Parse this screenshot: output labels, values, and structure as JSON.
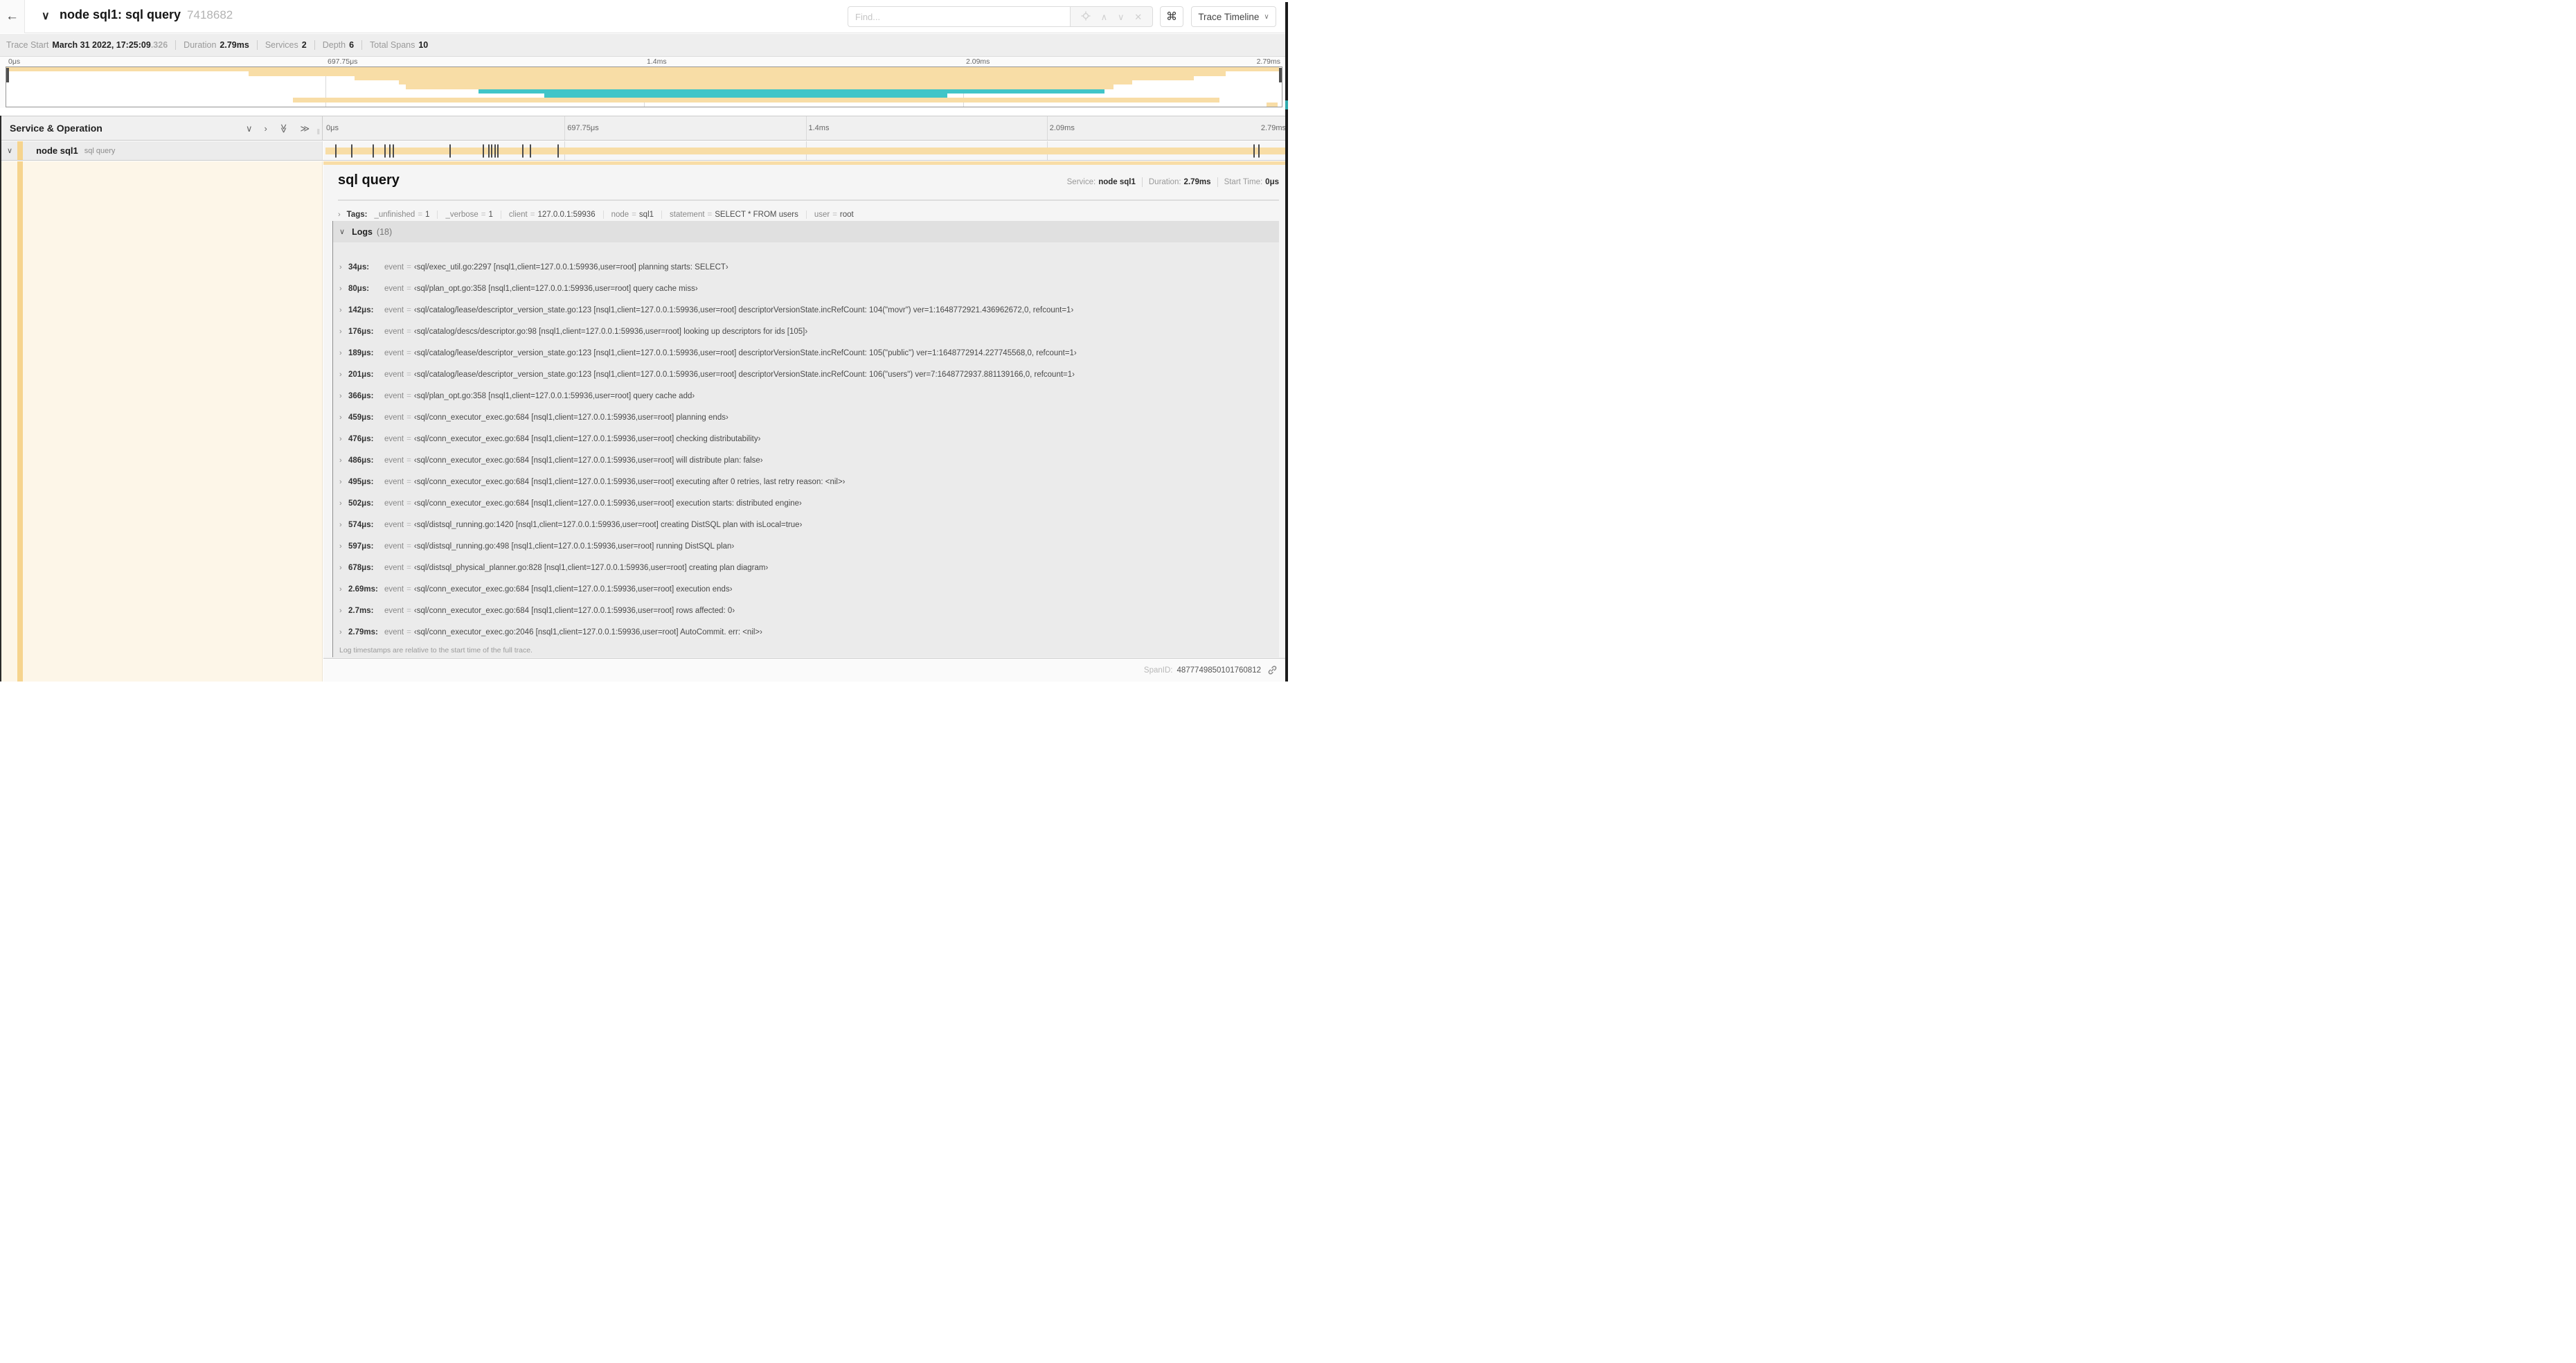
{
  "colors": {
    "tan": "#f8dda6",
    "teal": "#41c5c8",
    "accent": "#f6d48e",
    "cream": "#fdf6e8"
  },
  "icons": {
    "back": "←",
    "title_chevron": "∨",
    "command": "⌘",
    "view_chevron": "∨",
    "collapse_one": "∨",
    "expand_one": "›",
    "collapse_all": "≫",
    "expand_all": "≫",
    "grip": "‖",
    "nav_up": "∧",
    "nav_down": "∨",
    "close": "✕",
    "row_chevron": "∨",
    "tags_chevron": "›",
    "logs_chevron": "∨",
    "log_row_chevron": "›"
  },
  "header": {
    "title": "node sql1: sql query",
    "trace_id": "7418682",
    "find_placeholder": "Find...",
    "view_button": "Trace Timeline"
  },
  "meta": {
    "trace_start_label": "Trace Start",
    "trace_start_value": "March 31 2022, 17:25:09",
    "trace_start_frac": ".326",
    "duration_label": "Duration",
    "duration_value": "2.79ms",
    "services_label": "Services",
    "services_value": "2",
    "depth_label": "Depth",
    "depth_value": "6",
    "spans_label": "Total Spans",
    "spans_value": "10"
  },
  "ruler": {
    "ticks": [
      {
        "label": "0μs",
        "pos": 0
      },
      {
        "label": "697.75μs",
        "pos": 25
      },
      {
        "label": "1.4ms",
        "pos": 50
      },
      {
        "label": "2.09ms",
        "pos": 75
      },
      {
        "label": "2.79ms",
        "pos": 100
      }
    ],
    "gridlines": [
      25,
      50,
      75
    ]
  },
  "minimap": {
    "spans": [
      {
        "row": 0,
        "start": 0,
        "end": 99.8,
        "color": "#f8dda6"
      },
      {
        "row": 1,
        "start": 19,
        "end": 95.6,
        "color": "#f8dda6"
      },
      {
        "row": 2,
        "start": 27.3,
        "end": 93.1,
        "color": "#f8dda6"
      },
      {
        "row": 3,
        "start": 30.8,
        "end": 88.3,
        "color": "#f8dda6"
      },
      {
        "row": 4,
        "start": 31.3,
        "end": 86.8,
        "color": "#f8dda6"
      },
      {
        "row": 5,
        "start": 37,
        "end": 86.1,
        "color": "#41c5c8"
      },
      {
        "row": 6,
        "start": 42.2,
        "end": 73.8,
        "color": "#41c5c8"
      },
      {
        "row": 7,
        "start": 22.5,
        "end": 95.1,
        "color": "#f8dda6"
      },
      {
        "row": 8,
        "start": 98.8,
        "end": 99.7,
        "color": "#f8dda6"
      }
    ]
  },
  "timeline": {
    "panel_title": "Service & Operation",
    "row": {
      "service": "node sql1",
      "operation": "sql query"
    },
    "bar": {
      "start": 0.2,
      "end": 99.8,
      "color": "#f8dda6"
    },
    "log_tick_positions": [
      1.2,
      2.9,
      5.1,
      6.3,
      6.8,
      7.2,
      13.1,
      16.5,
      17.1,
      17.4,
      17.7,
      18.0,
      20.6,
      21.4,
      24.3,
      96.4,
      96.9
    ]
  },
  "detail": {
    "title": "sql query",
    "service_label": "Service:",
    "service_value": "node sql1",
    "duration_label": "Duration:",
    "duration_value": "2.79ms",
    "start_label": "Start Time:",
    "start_value": "0μs",
    "tags_label": "Tags:",
    "tags": [
      {
        "key": "_unfinished",
        "value": "1"
      },
      {
        "key": "_verbose",
        "value": "1"
      },
      {
        "key": "client",
        "value": "127.0.0.1:59936"
      },
      {
        "key": "node",
        "value": "sql1"
      },
      {
        "key": "statement",
        "value": "SELECT * FROM users"
      },
      {
        "key": "user",
        "value": "root"
      }
    ],
    "logs_label": "Logs",
    "logs_count": "(18)",
    "logs": [
      {
        "time": "34μs:",
        "key": "event",
        "value": "‹sql/exec_util.go:2297 [nsql1,client=127.0.0.1:59936,user=root] planning starts: SELECT›"
      },
      {
        "time": "80μs:",
        "key": "event",
        "value": "‹sql/plan_opt.go:358 [nsql1,client=127.0.0.1:59936,user=root] query cache miss›"
      },
      {
        "time": "142μs:",
        "key": "event",
        "value": "‹sql/catalog/lease/descriptor_version_state.go:123 [nsql1,client=127.0.0.1:59936,user=root] descriptorVersionState.incRefCount: 104(\"movr\") ver=1:1648772921.436962672,0, refcount=1›"
      },
      {
        "time": "176μs:",
        "key": "event",
        "value": "‹sql/catalog/descs/descriptor.go:98 [nsql1,client=127.0.0.1:59936,user=root] looking up descriptors for ids [105]›"
      },
      {
        "time": "189μs:",
        "key": "event",
        "value": "‹sql/catalog/lease/descriptor_version_state.go:123 [nsql1,client=127.0.0.1:59936,user=root] descriptorVersionState.incRefCount: 105(\"public\") ver=1:1648772914.227745568,0, refcount=1›"
      },
      {
        "time": "201μs:",
        "key": "event",
        "value": "‹sql/catalog/lease/descriptor_version_state.go:123 [nsql1,client=127.0.0.1:59936,user=root] descriptorVersionState.incRefCount: 106(\"users\") ver=7:1648772937.881139166,0, refcount=1›"
      },
      {
        "time": "366μs:",
        "key": "event",
        "value": "‹sql/plan_opt.go:358 [nsql1,client=127.0.0.1:59936,user=root] query cache add›"
      },
      {
        "time": "459μs:",
        "key": "event",
        "value": "‹sql/conn_executor_exec.go:684 [nsql1,client=127.0.0.1:59936,user=root] planning ends›"
      },
      {
        "time": "476μs:",
        "key": "event",
        "value": "‹sql/conn_executor_exec.go:684 [nsql1,client=127.0.0.1:59936,user=root] checking distributability›"
      },
      {
        "time": "486μs:",
        "key": "event",
        "value": "‹sql/conn_executor_exec.go:684 [nsql1,client=127.0.0.1:59936,user=root] will distribute plan: false›"
      },
      {
        "time": "495μs:",
        "key": "event",
        "value": "‹sql/conn_executor_exec.go:684 [nsql1,client=127.0.0.1:59936,user=root] executing after 0 retries, last retry reason: <nil>›"
      },
      {
        "time": "502μs:",
        "key": "event",
        "value": "‹sql/conn_executor_exec.go:684 [nsql1,client=127.0.0.1:59936,user=root] execution starts: distributed engine›"
      },
      {
        "time": "574μs:",
        "key": "event",
        "value": "‹sql/distsql_running.go:1420 [nsql1,client=127.0.0.1:59936,user=root] creating DistSQL plan with isLocal=true›"
      },
      {
        "time": "597μs:",
        "key": "event",
        "value": "‹sql/distsql_running.go:498 [nsql1,client=127.0.0.1:59936,user=root] running DistSQL plan›"
      },
      {
        "time": "678μs:",
        "key": "event",
        "value": "‹sql/distsql_physical_planner.go:828 [nsql1,client=127.0.0.1:59936,user=root] creating plan diagram›"
      },
      {
        "time": "2.69ms:",
        "key": "event",
        "value": "‹sql/conn_executor_exec.go:684 [nsql1,client=127.0.0.1:59936,user=root] execution ends›"
      },
      {
        "time": "2.7ms:",
        "key": "event",
        "value": "‹sql/conn_executor_exec.go:684 [nsql1,client=127.0.0.1:59936,user=root] rows affected: 0›"
      },
      {
        "time": "2.79ms:",
        "key": "event",
        "value": "‹sql/conn_executor_exec.go:2046 [nsql1,client=127.0.0.1:59936,user=root] AutoCommit. err: <nil>›"
      }
    ],
    "footer_note": "Log timestamps are relative to the start time of the full trace.",
    "spanid_label": "SpanID:",
    "spanid_value": "4877749850101760812"
  }
}
